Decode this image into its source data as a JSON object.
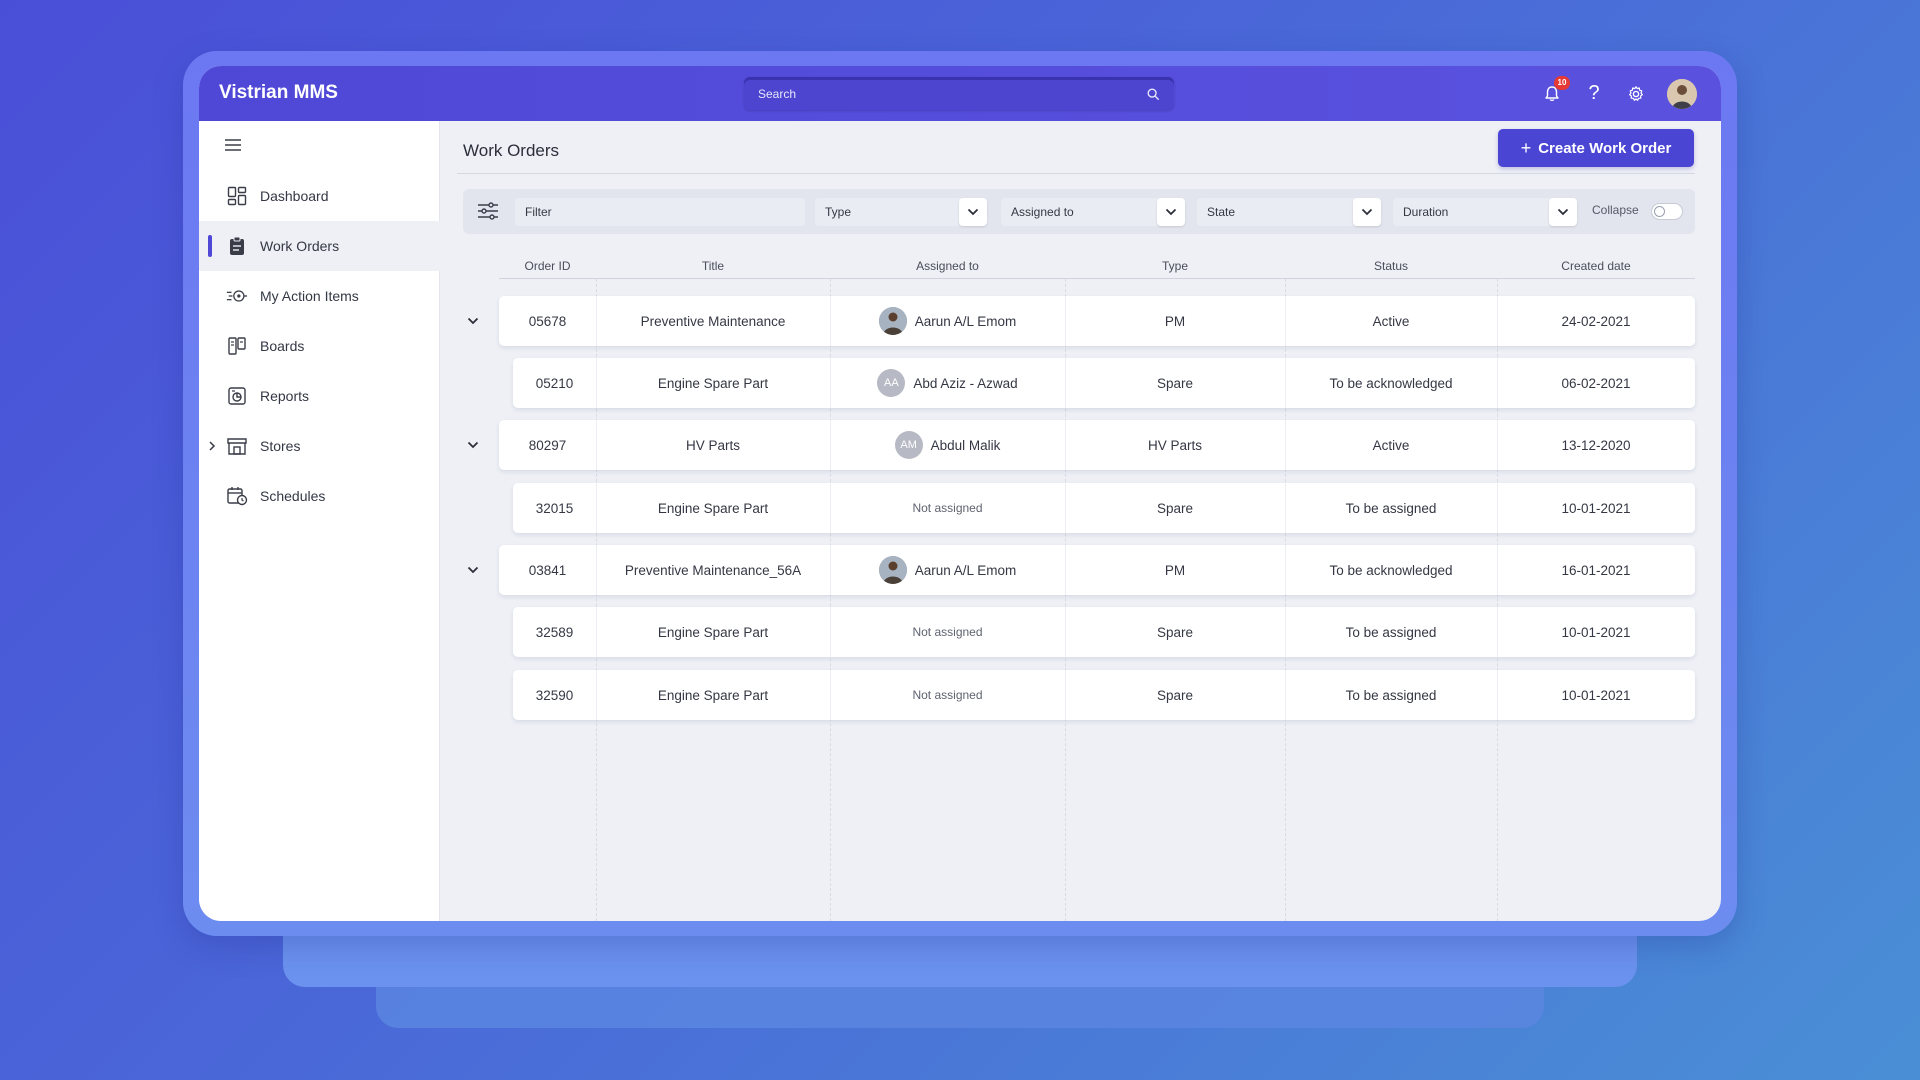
{
  "app": {
    "title": "Vistrian MMS"
  },
  "search": {
    "placeholder": "Search"
  },
  "header": {
    "notification_count": "10"
  },
  "sidebar": {
    "items": [
      {
        "label": "Dashboard",
        "icon": "dashboard-icon"
      },
      {
        "label": "Work Orders",
        "icon": "clipboard-icon",
        "active": true
      },
      {
        "label": "My Action Items",
        "icon": "target-icon"
      },
      {
        "label": "Boards",
        "icon": "boards-icon"
      },
      {
        "label": "Reports",
        "icon": "reports-icon"
      },
      {
        "label": "Stores",
        "icon": "store-icon",
        "expandable": true
      },
      {
        "label": "Schedules",
        "icon": "calendar-clock-icon"
      }
    ]
  },
  "main": {
    "title": "Work Orders",
    "create_button": "Create Work Order",
    "filters": {
      "filter_placeholder": "Filter",
      "type": "Type",
      "assigned_to": "Assigned to",
      "state": "State",
      "duration": "Duration",
      "collapse_label": "Collapse",
      "collapse_on": false
    },
    "table": {
      "headers": [
        "Order ID",
        "Title",
        "Assigned to",
        "Type",
        "Status",
        "Created date"
      ],
      "rows": [
        {
          "id": "05678",
          "title": "Preventive Maintenance",
          "assignee": "Aarun A/L Emom",
          "avatar": "photo",
          "type": "PM",
          "status": "Active",
          "date": "24-02-2021",
          "expandable": true
        },
        {
          "id": "05210",
          "title": "Engine Spare Part",
          "assignee": "Abd Aziz - Azwad",
          "avatar": "AA",
          "type": "Spare",
          "status": "To be acknowledged",
          "date": "06-02-2021",
          "expandable": false
        },
        {
          "id": "80297",
          "title": "HV Parts",
          "assignee": "Abdul Malik",
          "avatar": "AM",
          "type": "HV Parts",
          "status": "Active",
          "date": "13-12-2020",
          "expandable": true
        },
        {
          "id": "32015",
          "title": "Engine Spare Part",
          "assignee": "Not assigned",
          "avatar": "",
          "type": "Spare",
          "status": "To be assigned",
          "date": "10-01-2021",
          "expandable": false
        },
        {
          "id": "03841",
          "title": "Preventive Maintenance_56A",
          "assignee": "Aarun A/L Emom",
          "avatar": "photo",
          "type": "PM",
          "status": "To be acknowledged",
          "date": "16-01-2021",
          "expandable": true
        },
        {
          "id": "32589",
          "title": "Engine Spare Part",
          "assignee": "Not assigned",
          "avatar": "",
          "type": "Spare",
          "status": "To be assigned",
          "date": "10-01-2021",
          "expandable": false
        },
        {
          "id": "32590",
          "title": "Engine Spare Part",
          "assignee": "Not assigned",
          "avatar": "",
          "type": "Spare",
          "status": "To be assigned",
          "date": "10-01-2021",
          "expandable": false
        }
      ]
    }
  },
  "colors": {
    "brand": "#4f47d6",
    "background": "#4a68d8"
  }
}
